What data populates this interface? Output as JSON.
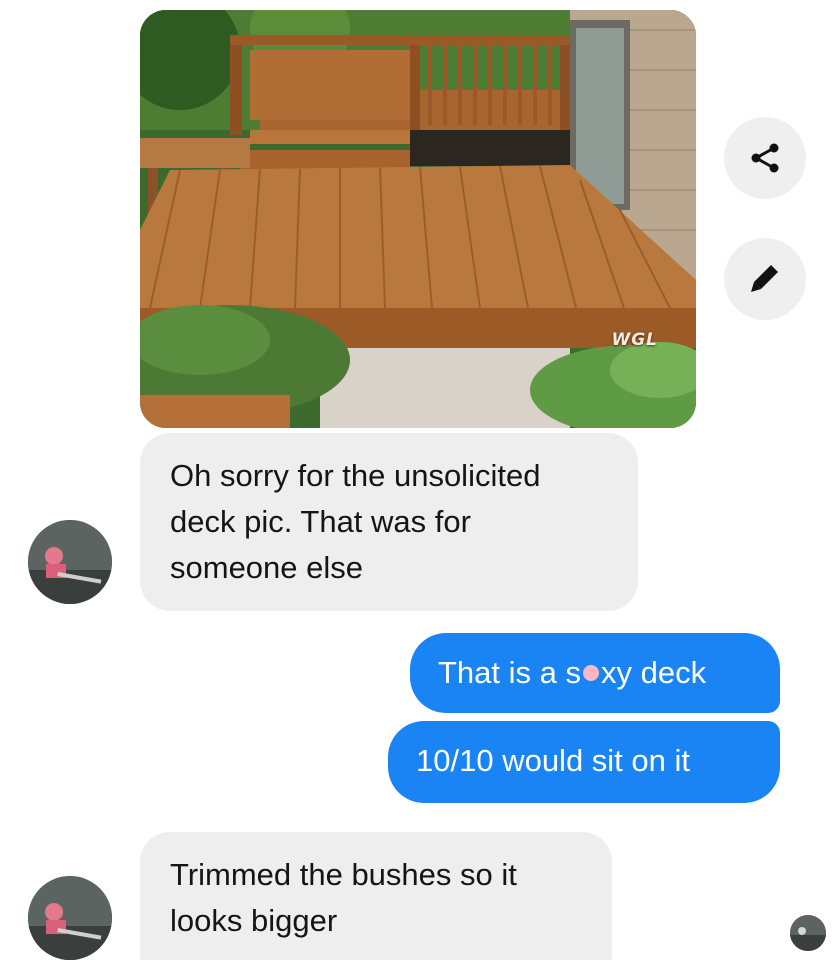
{
  "shared_image": {
    "description_icon": "photo",
    "watermark": "WGL"
  },
  "side_actions": {
    "share_icon": "share-icon",
    "edit_icon": "pencil-icon"
  },
  "messages": {
    "m1": "Oh sorry for the unsolicited deck pic. That was for someone else",
    "m1_lines": [
      "Oh sorry for the unsolicited",
      "deck pic. That was for",
      "someone else"
    ],
    "m2_before": "That is a s",
    "m2_after": "xy deck",
    "m3": "10/10 would sit on it",
    "m4_lines": [
      "Trimmed the bushes so it",
      "looks bigger"
    ]
  },
  "colors": {
    "incoming_bubble": "#eeeeee",
    "outgoing_bubble": "#1a84f5",
    "outgoing_text": "#ffffff"
  }
}
